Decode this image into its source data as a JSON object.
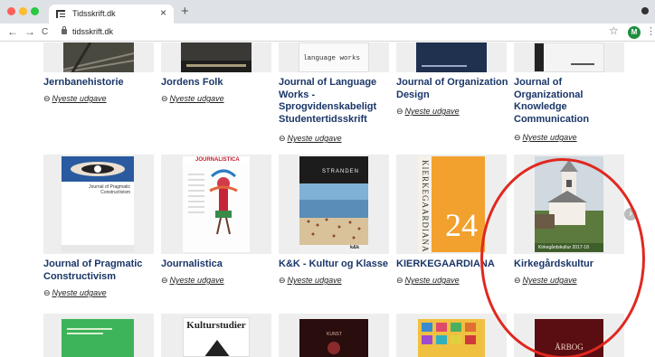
{
  "browser": {
    "tab_title": "Tidsskrift.dk",
    "tab_close": "×",
    "new_tab": "+",
    "url": "tidsskrift.dk",
    "back": "←",
    "forward": "→",
    "reload": "C",
    "bookmark_star": "☆",
    "profile_initial": "M",
    "menu": "⋮"
  },
  "journals": [
    {
      "title": "Jernbanehistorie",
      "link": "Nyeste udgave"
    },
    {
      "title": "Jordens Folk",
      "link": "Nyeste udgave"
    },
    {
      "title": "Journal of Language Works - Sprogvidenskabeligt Studentertidsskrift",
      "link": "Nyeste udgave"
    },
    {
      "title": "Journal of Organization Design",
      "link": "Nyeste udgave"
    },
    {
      "title": "Journal of Organizational Knowledge Communication",
      "link": "Nyeste udgave"
    },
    {
      "title": "Journal of Pragmatic Constructivism",
      "link": "Nyeste udgave"
    },
    {
      "title": "Journalistica",
      "link": "Nyeste udgave"
    },
    {
      "title": "K&K - Kultur og Klasse",
      "link": "Nyeste udgave"
    },
    {
      "title": "KIERKEGAARDIANA",
      "link": "Nyeste udgave"
    },
    {
      "title": "Kirkegårdskultur",
      "link": "Nyeste udgave"
    }
  ],
  "covers": {
    "lang_works": "language works",
    "pragmatic": "Journal of Pragmatic Constructivism",
    "journalistica": "JOURNALISTICA",
    "kk": "STRANDEN",
    "kk_logo": "k&k",
    "kierkegaard": "KIERKEGAARDIANA",
    "kierkegaard_num": "24",
    "kirkegard_caption": "Kirkegårdskultur 2017-18",
    "kulturstudier": "Kulturstudier",
    "kunst": "KUNST",
    "arbog": "ÅRBOG"
  },
  "link_icon": "⊖",
  "scroll_icon": "›",
  "colors": {
    "title_blue": "#1a3668",
    "highlight_circle": "#e0281f"
  }
}
